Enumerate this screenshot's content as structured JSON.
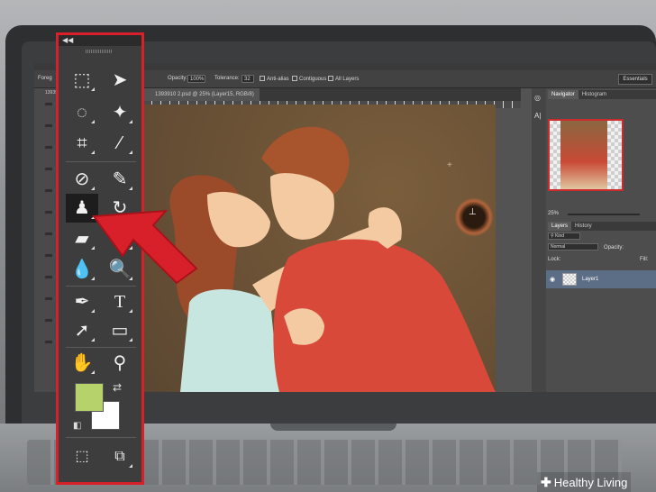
{
  "options_bar": {
    "app_menu_label": "Foreg",
    "opacity_label": "Opacity:",
    "opacity_value": "100%",
    "tolerance_label": "Tolerance:",
    "tolerance_value": "32",
    "anti_alias_label": "Anti-alias",
    "contiguous_label": "Contiguous",
    "all_layers_label": "All Layers",
    "workspace_label": "Essentials"
  },
  "document": {
    "tab_title": "1393910 2.psd @ 25% (Layer15, RGB/8)",
    "left_tab_title": "13939"
  },
  "panels": {
    "navigator_tab": "Navigator",
    "histogram_tab": "Histogram",
    "zoom_value": "25%",
    "layers_tab": "Layers",
    "history_tab": "History",
    "kind_label": "Kind",
    "blend_mode": "Normal",
    "opacity_label": "Opacity:",
    "lock_label": "Lock:",
    "fill_label": "Fill:",
    "layer_name": "Layer1"
  },
  "toolbar": {
    "collapse_glyph": "◀◀",
    "tools": [
      {
        "name": "marquee-tool-icon",
        "glyph": "⬚"
      },
      {
        "name": "move-tool-icon",
        "glyph": "➤"
      },
      {
        "name": "lasso-tool-icon",
        "glyph": "◌"
      },
      {
        "name": "magic-wand-tool-icon",
        "glyph": "✦"
      },
      {
        "name": "crop-tool-icon",
        "glyph": "⌗"
      },
      {
        "name": "eyedropper-tool-icon",
        "glyph": "⁄"
      },
      {
        "name": "healing-brush-tool-icon",
        "glyph": "⊘"
      },
      {
        "name": "brush-tool-icon",
        "glyph": "✎"
      },
      {
        "name": "clone-stamp-tool-icon",
        "glyph": "♟"
      },
      {
        "name": "history-brush-tool-icon",
        "glyph": "↻"
      },
      {
        "name": "eraser-tool-icon",
        "glyph": "▰"
      },
      {
        "name": "gradient-tool-icon",
        "glyph": "●"
      },
      {
        "name": "blur-tool-icon",
        "glyph": "💧"
      },
      {
        "name": "dodge-tool-icon",
        "glyph": "🔍"
      },
      {
        "name": "pen-tool-icon",
        "glyph": "✒"
      },
      {
        "name": "type-tool-icon",
        "glyph": "T"
      },
      {
        "name": "path-selection-tool-icon",
        "glyph": "➚"
      },
      {
        "name": "rectangle-tool-icon",
        "glyph": "▭"
      },
      {
        "name": "hand-tool-icon",
        "glyph": "✋"
      },
      {
        "name": "zoom-tool-icon",
        "glyph": "⚲"
      }
    ],
    "selected_tool": "clone-stamp-tool-icon",
    "foreground_color": "#b6d36b",
    "background_color": "#ffffff"
  },
  "annotation": {
    "arrow_color": "#d8202a"
  },
  "watermark": {
    "text": "Healthy Living"
  }
}
